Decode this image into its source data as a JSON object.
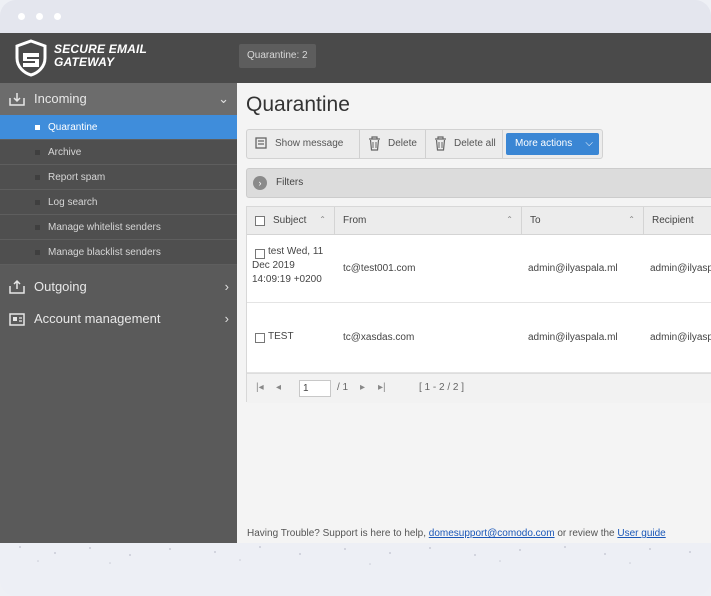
{
  "brand": {
    "line1": "SECURE EMAIL",
    "line2": "GATEWAY"
  },
  "header": {
    "quarantine_badge": "Quarantine: 2"
  },
  "sidebar": {
    "incoming": "Incoming",
    "items": [
      {
        "label": "Quarantine",
        "active": true
      },
      {
        "label": "Archive"
      },
      {
        "label": "Report spam"
      },
      {
        "label": "Log search"
      },
      {
        "label": "Manage whitelist senders"
      },
      {
        "label": "Manage blacklist senders"
      }
    ],
    "outgoing": "Outgoing",
    "account": "Account management"
  },
  "main": {
    "title": "Quarantine",
    "toolbar": {
      "show_message": "Show message",
      "delete": "Delete",
      "delete_all": "Delete all",
      "more_actions": "More actions"
    },
    "filters": "Filters",
    "columns": [
      "Subject",
      "From",
      "To",
      "Recipient"
    ],
    "rows": [
      {
        "subject_lines": [
          "test Wed, 11",
          "Dec 2019",
          "14:09:19 +0200"
        ],
        "from": "tc@test001.com",
        "to": "admin@ilyaspala.ml",
        "recipient": "admin@ilyasp"
      },
      {
        "subject_lines": [
          "TEST"
        ],
        "from": "tc@xasdas.com",
        "to": "admin@ilyaspala.ml",
        "recipient": "admin@ilyasp"
      }
    ],
    "pager": {
      "page": "1",
      "of": "/ 1",
      "range": "[ 1 - 2 / 2 ]"
    }
  },
  "footer": {
    "prefix": "Having Trouble? Support is here to help,",
    "email": "domesupport@comodo.com",
    "middle": "or review the",
    "guide": "User guide"
  },
  "colors": {
    "accent": "#3f8ddb",
    "topbar": "#4a4a4a",
    "sidebar": "#5a5a5a"
  }
}
